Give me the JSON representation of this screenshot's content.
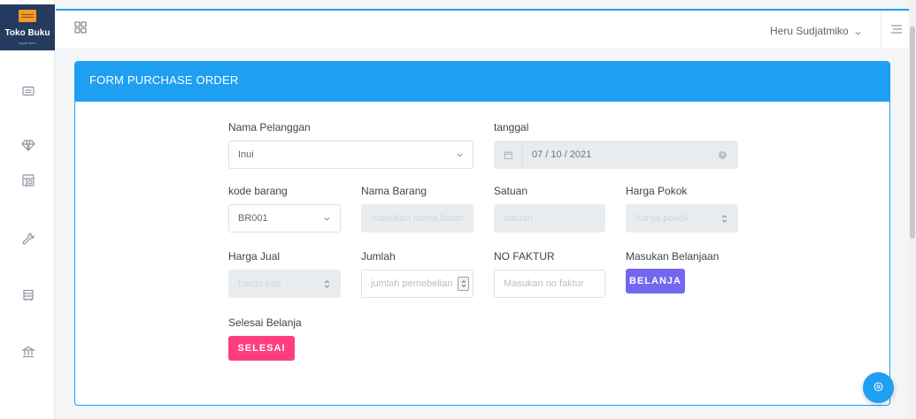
{
  "brand": {
    "name": "Toko Buku",
    "tagline": "toyah store",
    "color": "#243a5e"
  },
  "sidebar": {
    "icons": [
      "mail-icon",
      "diamond-icon",
      "package-icon",
      "wrench-icon",
      "shopping-cart-icon",
      "bank-icon"
    ]
  },
  "topbar": {
    "user_name": "Heru Sudjatmiko",
    "accent": "#1e9ff2"
  },
  "card": {
    "title": "FORM PURCHASE ORDER"
  },
  "form": {
    "nama_pelanggan": {
      "label": "Nama Pelanggan",
      "value": "Inui"
    },
    "tanggal": {
      "label": "tanggal",
      "value": "07 / 10 / 2021"
    },
    "kode_barang": {
      "label": "kode barang",
      "value": "BR001"
    },
    "nama_barang": {
      "label": "Nama Barang",
      "placeholder": "masukan nama barang"
    },
    "satuan": {
      "label": "Satuan",
      "placeholder": "satuan"
    },
    "harga_pokok": {
      "label": "Harga Pokok",
      "placeholder": "harga pokok"
    },
    "harga_jual": {
      "label": "Harga Jual",
      "placeholder": "harga jual"
    },
    "jumlah": {
      "label": "Jumlah",
      "placeholder": "jumlah pemebelian"
    },
    "no_faktur": {
      "label": "NO FAKTUR",
      "placeholder": "Masukan no faktur"
    },
    "masukan_belanjaan": {
      "label": "Masukan Belanjaan",
      "button": "BELANJA"
    },
    "selesai_belanja": {
      "label": "Selesai Belanja",
      "button": "SELESAI"
    }
  },
  "colors": {
    "primary": "#1e9ff2",
    "belanja": "#7367f0",
    "selesai": "#ff3d7f"
  }
}
